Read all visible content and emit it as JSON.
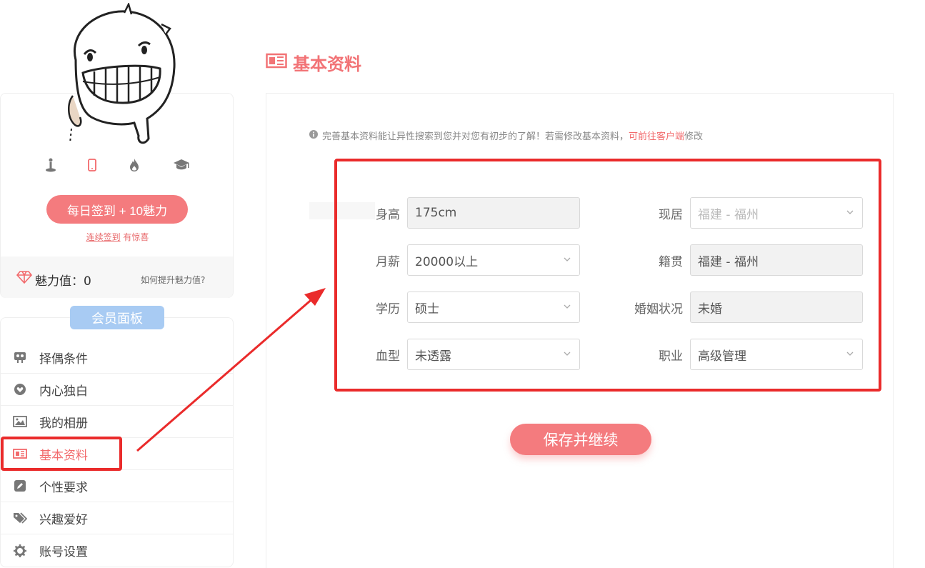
{
  "profile": {
    "icons": [
      "location-icon",
      "phone-icon",
      "fire-icon",
      "graduation-cap-icon"
    ],
    "checkin_label": "每日签到 + 10魅力",
    "streak_link": "连续签到",
    "streak_suffix": " 有惊喜",
    "charm_label": "魅力值：0",
    "charm_help": "如何提升魅力值?"
  },
  "panel": {
    "title": "会员面板",
    "items": [
      {
        "label": "择偶条件",
        "icon": "partner-icon"
      },
      {
        "label": "内心独白",
        "icon": "heart-icon"
      },
      {
        "label": "我的相册",
        "icon": "image-icon"
      },
      {
        "label": "基本资料",
        "icon": "newspaper-icon",
        "active": true
      },
      {
        "label": "个性要求",
        "icon": "edit-icon"
      },
      {
        "label": "兴趣爱好",
        "icon": "tags-icon"
      },
      {
        "label": "账号设置",
        "icon": "gear-icon"
      }
    ]
  },
  "section": {
    "title": "基本资料"
  },
  "notice": {
    "text": "完善基本资料能让异性搜索到您并对您有初步的了解！若需修改基本资料，",
    "link": "可前往客户端",
    "suffix": "修改"
  },
  "form": {
    "height": {
      "label": "身高",
      "value": "175cm"
    },
    "salary": {
      "label": "月薪",
      "value": "20000以上"
    },
    "education": {
      "label": "学历",
      "value": "硕士"
    },
    "blood": {
      "label": "血型",
      "value": "未透露"
    },
    "residence": {
      "label": "现居",
      "value": "福建 - 福州"
    },
    "hometown": {
      "label": "籍贯",
      "value": "福建 - 福州"
    },
    "marital": {
      "label": "婚姻状况",
      "value": "未婚"
    },
    "job": {
      "label": "职业",
      "value": "高级管理"
    }
  },
  "save_label": "保存并继续",
  "colors": {
    "accent": "#f47b7e",
    "highlight": "#ea2b2b",
    "panel_title": "#a8cbf3"
  }
}
